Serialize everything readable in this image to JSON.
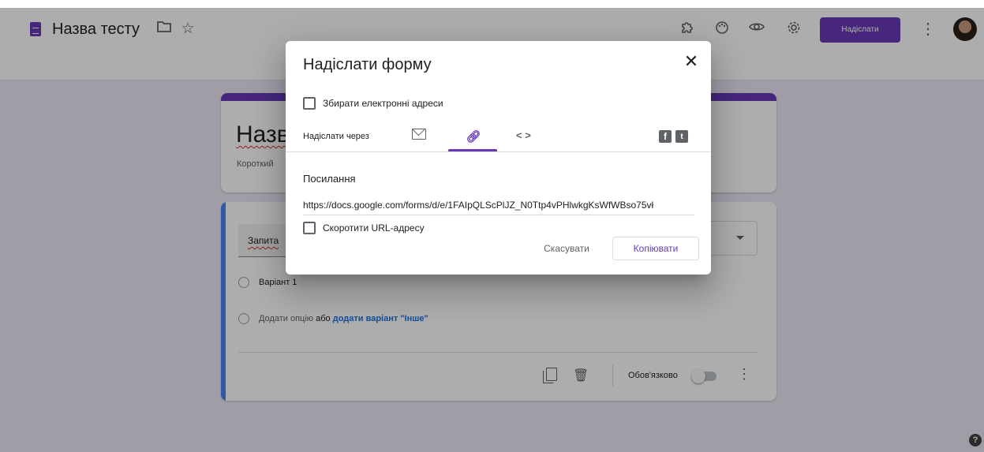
{
  "header": {
    "form_title": "Назва тесту",
    "icons": [
      "docs-form-icon",
      "folder-icon",
      "star-icon",
      "addon-puzzle-icon",
      "palette-icon",
      "preview-eye-icon",
      "settings-gear-icon",
      "more-vert-icon"
    ],
    "send_label": "Надіслати",
    "accent_color": "#673ab7"
  },
  "form": {
    "title_partial": "Назв",
    "description_partial": "Короткий",
    "question_partial": "Запита",
    "option1": "Варіант 1",
    "add_option": "Додати опцію",
    "or": "або",
    "add_other": "додати варіант \"Інше\"",
    "required_label": "Обов'язково"
  },
  "dialog": {
    "title": "Надіслати форму",
    "collect_emails_label": "Збирати електронні адреси",
    "send_via_label": "Надіслати через",
    "tabs": [
      "email-icon",
      "link-icon",
      "embed-html-icon"
    ],
    "active_tab": "link-icon",
    "social": [
      "facebook-icon",
      "twitter-icon"
    ],
    "link_heading": "Посилання",
    "url": "https://docs.google.com/forms/d/e/1FAIpQLScPlJZ_N0Ttp4vPHlwkgKsWfWBso75vł",
    "shorten_url_label": "Скоротити URL-адресу",
    "cancel_label": "Скасувати",
    "copy_label": "Копіювати"
  }
}
